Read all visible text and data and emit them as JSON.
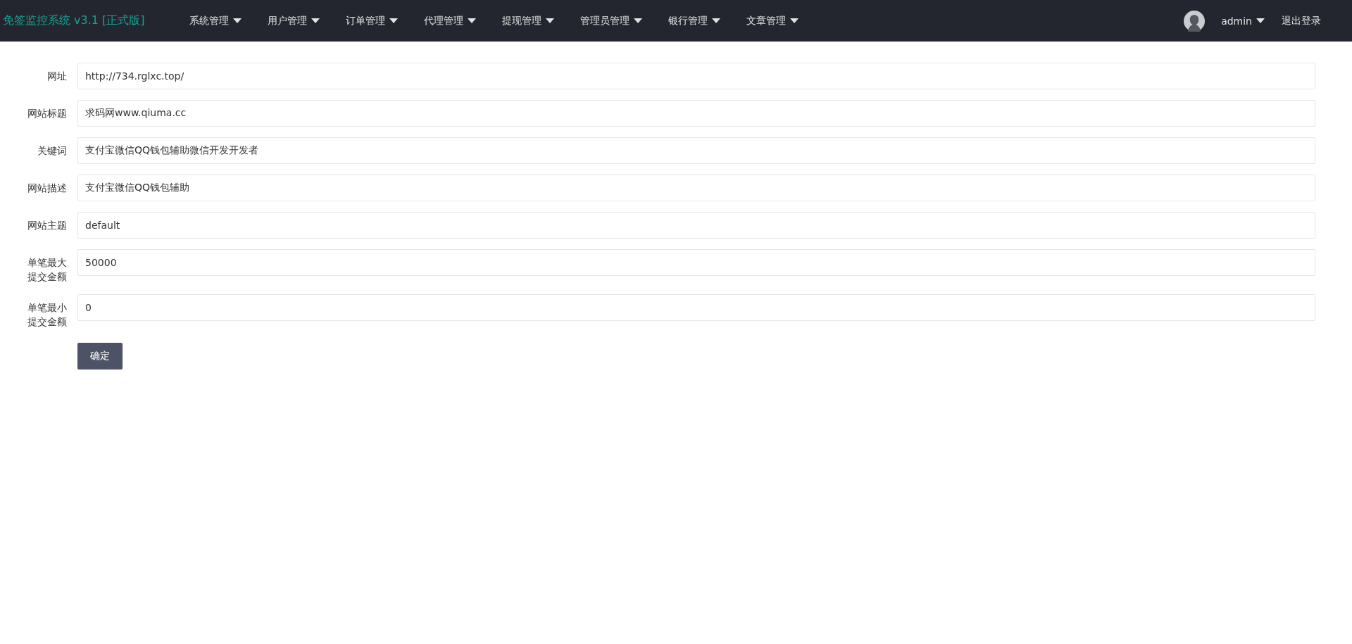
{
  "navbar": {
    "brand": "免签监控系统 v3.1 [正式版]",
    "menu": [
      "系统管理",
      "用户管理",
      "订单管理",
      "代理管理",
      "提现管理",
      "管理员管理",
      "银行管理",
      "文章管理"
    ],
    "user": "admin",
    "logout": "退出登录"
  },
  "form": {
    "fields": [
      {
        "label": "网址",
        "value": "http://734.rglxc.top/"
      },
      {
        "label": "网站标题",
        "value": "求码网www.qiuma.cc"
      },
      {
        "label": "关键词",
        "value": "支付宝微信QQ钱包辅助微信开发开发者"
      },
      {
        "label": "网站描述",
        "value": "支付宝微信QQ钱包辅助"
      },
      {
        "label": "网站主题",
        "value": "default"
      },
      {
        "label": "单笔最大提交金额",
        "value": "50000"
      },
      {
        "label": "单笔最小提交金额",
        "value": "0"
      }
    ],
    "submit": "确定"
  }
}
